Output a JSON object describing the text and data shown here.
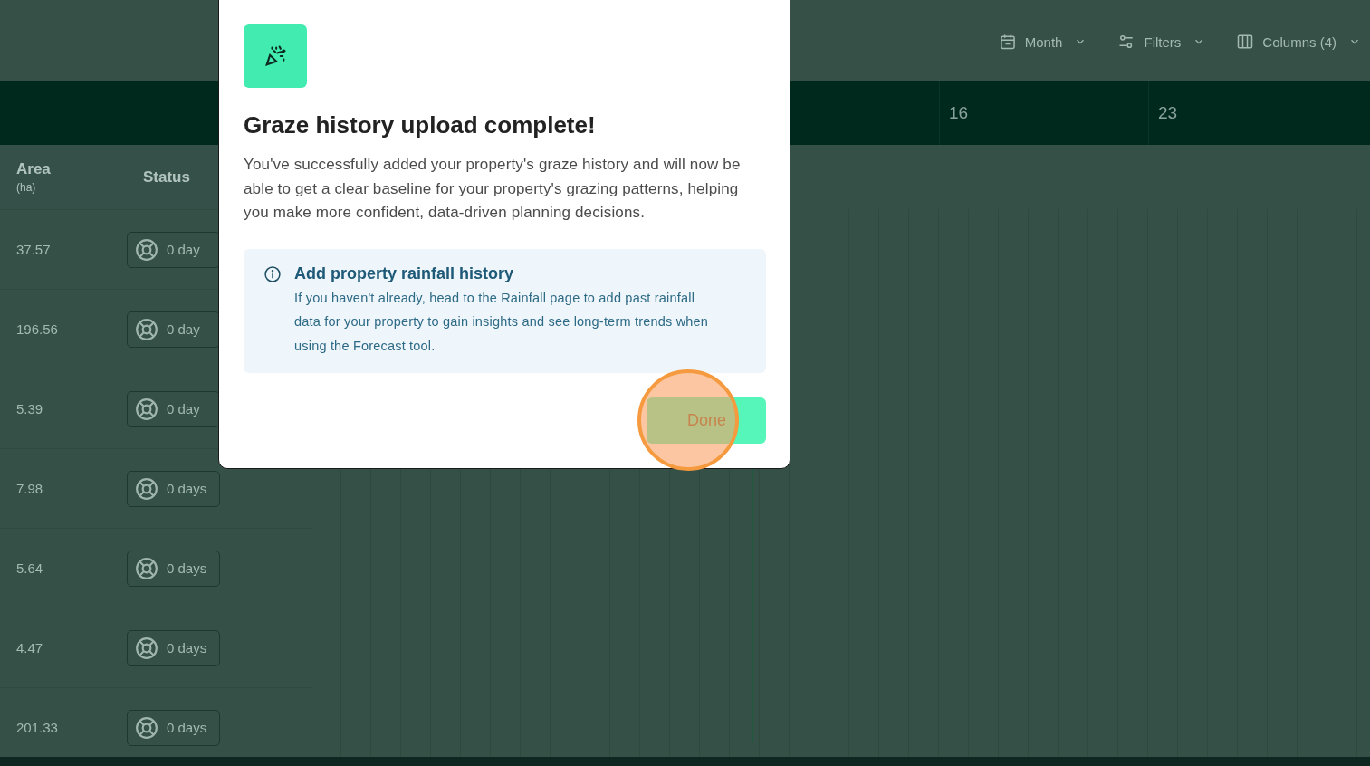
{
  "toolbar": [
    {
      "label": "Month"
    },
    {
      "label": "Filters"
    },
    {
      "label": "Columns (4)"
    }
  ],
  "calendar_header": {
    "days": [
      "16",
      "23"
    ]
  },
  "table": {
    "columns": [
      {
        "label": "Area",
        "unit": "(ha)"
      },
      {
        "label": "Status"
      }
    ],
    "rows": [
      {
        "area": "37.57",
        "status": "0 day"
      },
      {
        "area": "196.56",
        "status": "0 day"
      },
      {
        "area": "5.39",
        "status": "0 day"
      },
      {
        "area": "7.98",
        "status": "0 days"
      },
      {
        "area": "5.64",
        "status": "0 days"
      },
      {
        "area": "4.47",
        "status": "0 days"
      },
      {
        "area": "201.33",
        "status": "0 days"
      }
    ]
  },
  "dialog": {
    "title": "Graze history upload complete!",
    "message": "You've successfully added your property's graze history and will now be able to get a clear baseline for your property's grazing patterns, helping you make more confident, data-driven planning decisions.",
    "info": {
      "title": "Add property rainfall history",
      "text": "If you haven't already, head to the Rainfall page to add past rainfall data for your property to gain insights and see long-term trends when using the Forecast tool."
    },
    "button": "Done"
  }
}
